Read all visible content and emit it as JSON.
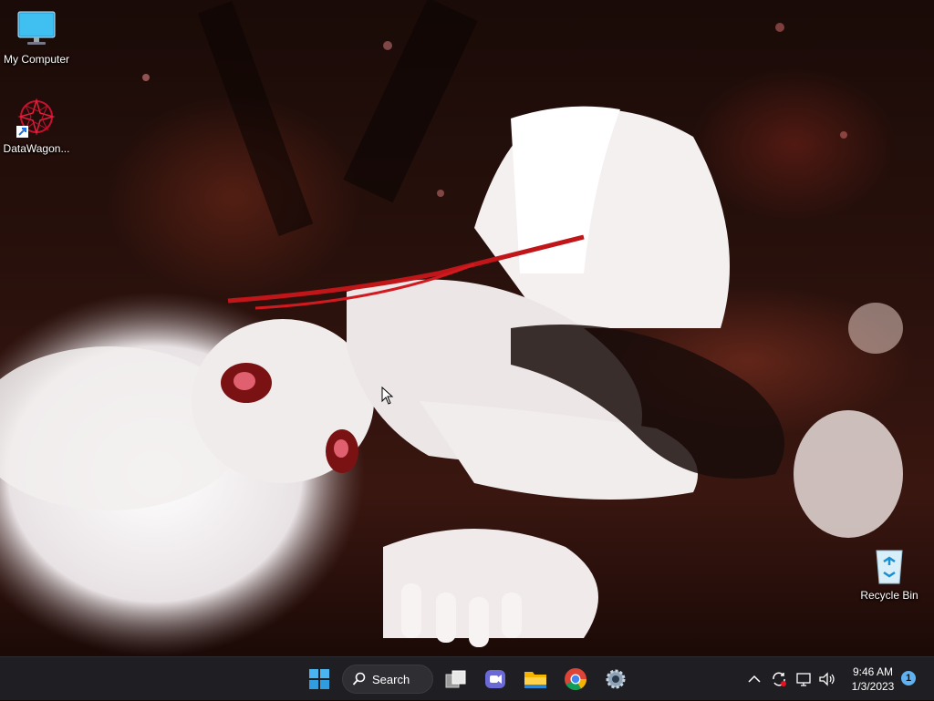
{
  "desktop": {
    "icons": [
      {
        "label": "My Computer",
        "icon": "monitor-icon"
      },
      {
        "label": "DataWagon...",
        "icon": "datawagon-logo-icon"
      },
      {
        "label": "Recycle Bin",
        "icon": "recycle-bin-icon"
      }
    ]
  },
  "taskbar": {
    "search_label": "Search",
    "apps": [
      "start-icon",
      "task-view-icon",
      "teams-chat-icon",
      "file-explorer-icon",
      "chrome-icon",
      "settings-icon"
    ],
    "tray": {
      "time": "9:46 AM",
      "date": "1/3/2023",
      "notification_count": "1"
    }
  },
  "colors": {
    "taskbar_bg": "#1f1f23",
    "accent": "#5fb2f2"
  }
}
